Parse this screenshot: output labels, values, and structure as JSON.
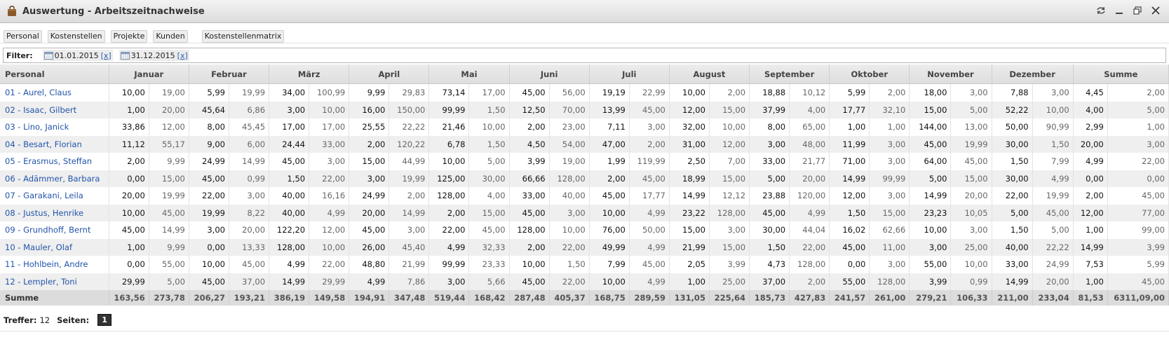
{
  "window": {
    "title": "Auswertung - Arbeitszeitnachweise",
    "icons": [
      "bag-icon",
      "refresh-icon",
      "minimize-icon",
      "maximize-icon",
      "close-icon"
    ]
  },
  "toolbar": {
    "tabs": [
      "Personal",
      "Kostenstellen",
      "Projekte",
      "Kunden",
      "Kostenstellenmatrix"
    ]
  },
  "filter": {
    "label": "Filter:",
    "from": "01.01.2015",
    "to": "31.12.2015",
    "clear": "[x]"
  },
  "table": {
    "first_header": "Personal",
    "months": [
      "Januar",
      "Februar",
      "März",
      "April",
      "Mai",
      "Juni",
      "Juli",
      "August",
      "September",
      "Oktober",
      "November",
      "Dezember",
      "Summe"
    ],
    "rows": [
      {
        "name": "01 - Aurel, Claus",
        "values": [
          [
            "10,00",
            "19,00"
          ],
          [
            "5,99",
            "19,99"
          ],
          [
            "34,00",
            "100,99"
          ],
          [
            "9,99",
            "29,83"
          ],
          [
            "73,14",
            "17,00"
          ],
          [
            "45,00",
            "56,00"
          ],
          [
            "19,19",
            "22,99"
          ],
          [
            "10,00",
            "2,00"
          ],
          [
            "18,88",
            "10,12"
          ],
          [
            "5,99",
            "2,00"
          ],
          [
            "18,00",
            "3,00"
          ],
          [
            "7,88",
            "3,00"
          ],
          [
            "4,45",
            "2,00"
          ]
        ]
      },
      {
        "name": "02 - Isaac, Gilbert",
        "values": [
          [
            "1,00",
            "20,00"
          ],
          [
            "45,64",
            "6,86"
          ],
          [
            "3,00",
            "10,00"
          ],
          [
            "16,00",
            "150,00"
          ],
          [
            "99,99",
            "1,50"
          ],
          [
            "12,50",
            "70,00"
          ],
          [
            "13,99",
            "45,00"
          ],
          [
            "12,00",
            "15,00"
          ],
          [
            "37,99",
            "4,00"
          ],
          [
            "17,77",
            "32,10"
          ],
          [
            "15,00",
            "5,00"
          ],
          [
            "52,22",
            "10,00"
          ],
          [
            "4,00",
            "5,00"
          ]
        ]
      },
      {
        "name": "03 - Lino, Janick",
        "values": [
          [
            "33,86",
            "12,00"
          ],
          [
            "8,00",
            "45,45"
          ],
          [
            "17,00",
            "17,00"
          ],
          [
            "25,55",
            "22,22"
          ],
          [
            "21,46",
            "10,00"
          ],
          [
            "2,00",
            "23,00"
          ],
          [
            "7,11",
            "3,00"
          ],
          [
            "32,00",
            "10,00"
          ],
          [
            "8,00",
            "65,00"
          ],
          [
            "1,00",
            "1,00"
          ],
          [
            "144,00",
            "13,00"
          ],
          [
            "50,00",
            "90,99"
          ],
          [
            "2,99",
            "1,00"
          ]
        ]
      },
      {
        "name": "04 - Besart, Florian",
        "values": [
          [
            "11,12",
            "55,17"
          ],
          [
            "9,00",
            "6,00"
          ],
          [
            "24,44",
            "33,00"
          ],
          [
            "2,00",
            "120,22"
          ],
          [
            "6,78",
            "1,50"
          ],
          [
            "4,50",
            "54,00"
          ],
          [
            "47,00",
            "2,00"
          ],
          [
            "31,00",
            "12,00"
          ],
          [
            "3,00",
            "48,00"
          ],
          [
            "11,99",
            "3,00"
          ],
          [
            "45,00",
            "19,99"
          ],
          [
            "30,00",
            "1,50"
          ],
          [
            "20,00",
            "3,00"
          ]
        ]
      },
      {
        "name": "05 - Erasmus, Steffan",
        "values": [
          [
            "2,00",
            "9,99"
          ],
          [
            "24,99",
            "14,99"
          ],
          [
            "45,00",
            "3,00"
          ],
          [
            "15,00",
            "44,99"
          ],
          [
            "10,00",
            "5,00"
          ],
          [
            "3,99",
            "19,00"
          ],
          [
            "1,99",
            "119,99"
          ],
          [
            "2,50",
            "7,00"
          ],
          [
            "33,00",
            "21,77"
          ],
          [
            "71,00",
            "3,00"
          ],
          [
            "64,00",
            "45,00"
          ],
          [
            "1,50",
            "7,99"
          ],
          [
            "4,99",
            "22,00"
          ]
        ]
      },
      {
        "name": "06 - Adämmer, Barbara",
        "values": [
          [
            "0,00",
            "15,00"
          ],
          [
            "45,00",
            "0,99"
          ],
          [
            "1,50",
            "22,00"
          ],
          [
            "3,00",
            "19,99"
          ],
          [
            "125,00",
            "30,00"
          ],
          [
            "66,66",
            "128,00"
          ],
          [
            "2,00",
            "45,00"
          ],
          [
            "18,99",
            "15,00"
          ],
          [
            "5,00",
            "20,00"
          ],
          [
            "14,99",
            "99,99"
          ],
          [
            "5,00",
            "15,00"
          ],
          [
            "30,00",
            "4,99"
          ],
          [
            "0,00",
            "0,00"
          ]
        ]
      },
      {
        "name": "07 - Garakani, Leila",
        "values": [
          [
            "20,00",
            "19,99"
          ],
          [
            "22,00",
            "3,00"
          ],
          [
            "40,00",
            "16,16"
          ],
          [
            "24,99",
            "2,00"
          ],
          [
            "128,00",
            "4,00"
          ],
          [
            "33,00",
            "40,00"
          ],
          [
            "45,00",
            "17,77"
          ],
          [
            "14,99",
            "12,12"
          ],
          [
            "23,88",
            "120,00"
          ],
          [
            "12,00",
            "3,00"
          ],
          [
            "14,99",
            "20,00"
          ],
          [
            "22,00",
            "19,99"
          ],
          [
            "2,00",
            "45,00"
          ]
        ]
      },
      {
        "name": "08 - Justus, Henrike",
        "values": [
          [
            "10,00",
            "45,00"
          ],
          [
            "19,99",
            "8,22"
          ],
          [
            "40,00",
            "4,99"
          ],
          [
            "20,00",
            "14,99"
          ],
          [
            "2,00",
            "15,00"
          ],
          [
            "45,00",
            "3,00"
          ],
          [
            "10,00",
            "4,99"
          ],
          [
            "23,22",
            "128,00"
          ],
          [
            "45,00",
            "4,99"
          ],
          [
            "1,50",
            "15,00"
          ],
          [
            "23,23",
            "10,05"
          ],
          [
            "5,00",
            "45,00"
          ],
          [
            "12,00",
            "77,00"
          ]
        ]
      },
      {
        "name": "09 - Grundhoff, Bernt",
        "values": [
          [
            "45,00",
            "14,99"
          ],
          [
            "3,00",
            "20,00"
          ],
          [
            "122,20",
            "12,00"
          ],
          [
            "45,00",
            "3,00"
          ],
          [
            "22,00",
            "45,00"
          ],
          [
            "128,00",
            "10,00"
          ],
          [
            "76,00",
            "50,00"
          ],
          [
            "15,00",
            "3,00"
          ],
          [
            "30,00",
            "44,04"
          ],
          [
            "16,02",
            "62,66"
          ],
          [
            "10,00",
            "3,00"
          ],
          [
            "1,50",
            "5,00"
          ],
          [
            "1,00",
            "99,00"
          ]
        ]
      },
      {
        "name": "10 - Mauler, Olaf",
        "values": [
          [
            "1,00",
            "9,99"
          ],
          [
            "0,00",
            "13,33"
          ],
          [
            "128,00",
            "10,00"
          ],
          [
            "26,00",
            "45,40"
          ],
          [
            "4,99",
            "32,33"
          ],
          [
            "2,00",
            "22,00"
          ],
          [
            "49,99",
            "4,99"
          ],
          [
            "21,99",
            "15,00"
          ],
          [
            "1,50",
            "22,00"
          ],
          [
            "45,00",
            "11,00"
          ],
          [
            "3,00",
            "25,00"
          ],
          [
            "40,00",
            "22,22"
          ],
          [
            "14,99",
            "3,99"
          ]
        ]
      },
      {
        "name": "11 - Hohlbein, Andre",
        "values": [
          [
            "0,00",
            "55,00"
          ],
          [
            "10,00",
            "45,00"
          ],
          [
            "4,99",
            "22,00"
          ],
          [
            "48,80",
            "21,99"
          ],
          [
            "99,99",
            "23,33"
          ],
          [
            "10,00",
            "1,50"
          ],
          [
            "7,99",
            "45,00"
          ],
          [
            "2,05",
            "3,99"
          ],
          [
            "4,73",
            "128,00"
          ],
          [
            "0,00",
            "3,00"
          ],
          [
            "55,00",
            "10,00"
          ],
          [
            "33,00",
            "24,99"
          ],
          [
            "7,53",
            "5,99"
          ]
        ]
      },
      {
        "name": "12 - Lempler, Toni",
        "values": [
          [
            "29,99",
            "5,00"
          ],
          [
            "45,00",
            "37,00"
          ],
          [
            "14,99",
            "29,99"
          ],
          [
            "4,99",
            "7,86"
          ],
          [
            "3,00",
            "5,66"
          ],
          [
            "45,00",
            "22,00"
          ],
          [
            "10,00",
            "4,99"
          ],
          [
            "1,00",
            "25,00"
          ],
          [
            "37,00",
            "2,00"
          ],
          [
            "55,00",
            "128,00"
          ],
          [
            "3,99",
            "0,99"
          ],
          [
            "14,99",
            "20,00"
          ],
          [
            "1,00",
            "45,00"
          ]
        ]
      }
    ],
    "sum_row": {
      "name": "Summe",
      "values": [
        [
          "163,56",
          "273,78"
        ],
        [
          "206,27",
          "193,21"
        ],
        [
          "386,19",
          "149,58"
        ],
        [
          "194,91",
          "347,48"
        ],
        [
          "519,44",
          "168,42"
        ],
        [
          "287,48",
          "405,37"
        ],
        [
          "168,75",
          "289,59"
        ],
        [
          "131,05",
          "225,64"
        ],
        [
          "185,73",
          "427,83"
        ],
        [
          "241,57",
          "261,00"
        ],
        [
          "279,21",
          "106,33"
        ],
        [
          "211,00",
          "233,04"
        ],
        [
          "81,53",
          "6311,09,00"
        ]
      ]
    }
  },
  "footer": {
    "hits_label": "Treffer:",
    "hits_value": "12",
    "pages_label": "Seiten:",
    "current_page": "1"
  }
}
